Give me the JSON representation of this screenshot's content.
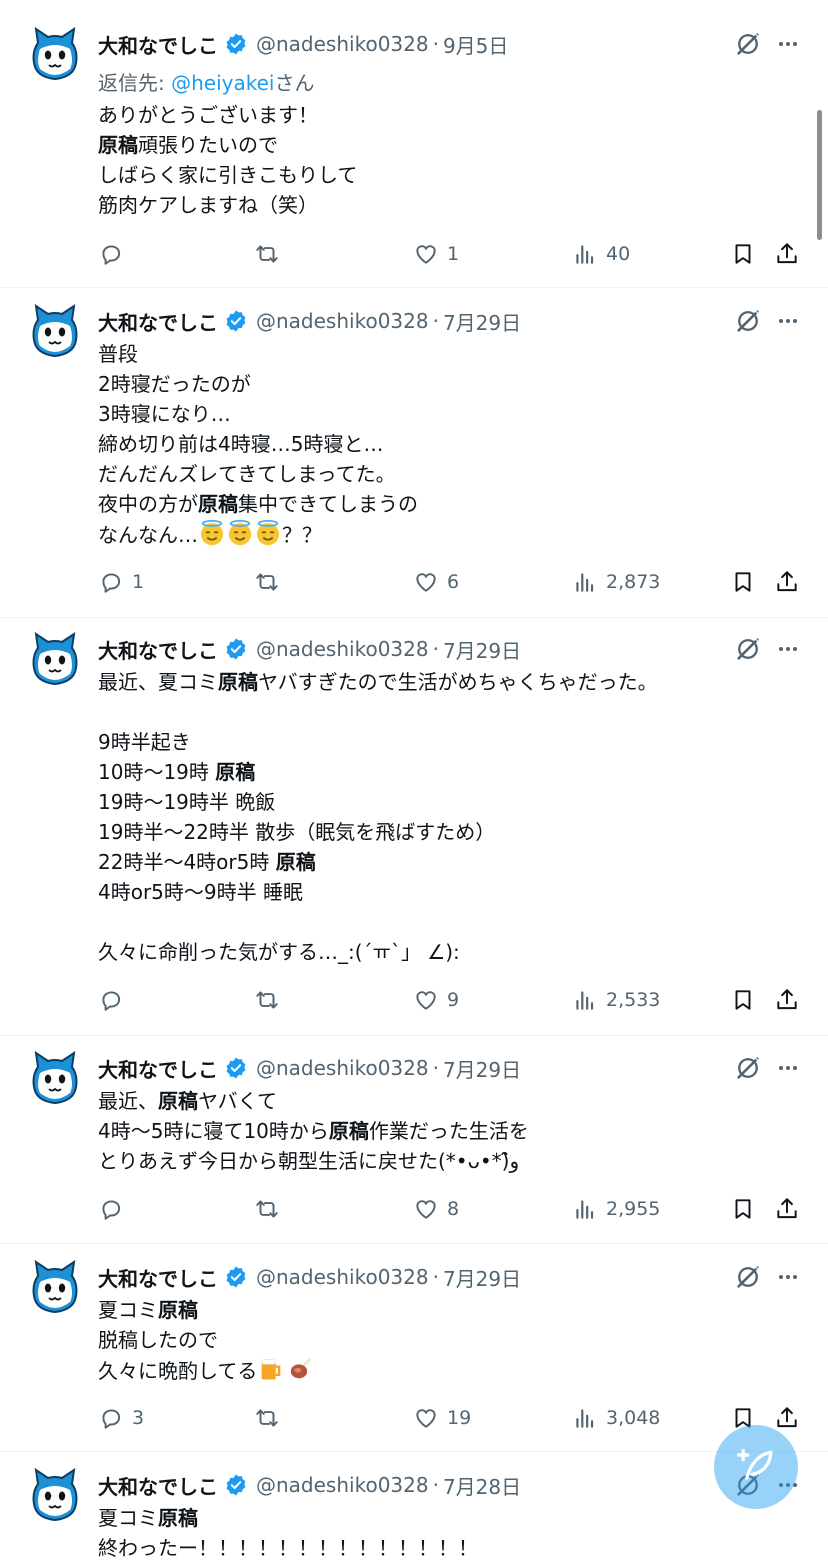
{
  "author": {
    "name": "大和なでしこ",
    "handle": "@nadeshiko0328",
    "separator": "·"
  },
  "icons": {
    "reply": "reply-icon",
    "retweet": "retweet-icon",
    "like": "heart-icon",
    "views": "views-chart-icon",
    "bookmark": "bookmark-icon",
    "share": "share-icon",
    "grok": "grok-icon",
    "more": "more-icon",
    "verified": "verified-badge-icon",
    "compose": "compose-icon"
  },
  "colors": {
    "accent": "#1d9bf0",
    "muted": "#536471",
    "text": "#0f1419"
  },
  "tweets": [
    {
      "date": "9月5日",
      "reply_to": {
        "prefix": "返信先: ",
        "mention": "@heiyakei",
        "suffix": "さん"
      },
      "lines": [
        [
          {
            "t": "ありがとうございます！"
          }
        ],
        [
          {
            "t": "原稿",
            "b": true
          },
          {
            "t": "頑張りたいので"
          }
        ],
        [
          {
            "t": "しばらく家に引きこもりして"
          }
        ],
        [
          {
            "t": "筋肉ケアしますね（笑）"
          }
        ]
      ],
      "replies": "",
      "retweets": "",
      "likes": "1",
      "views": "40"
    },
    {
      "date": "7月29日",
      "lines": [
        [
          {
            "t": "普段"
          }
        ],
        [
          {
            "t": "2時寝だったのが"
          }
        ],
        [
          {
            "t": "3時寝になり…"
          }
        ],
        [
          {
            "t": "締め切り前は4時寝…5時寝と…"
          }
        ],
        [
          {
            "t": "だんだんズレてきてしまってた。"
          }
        ],
        [
          {
            "t": "夜中の方が"
          },
          {
            "t": "原稿",
            "b": true
          },
          {
            "t": "集中できてしまうの"
          }
        ],
        [
          {
            "t": "なんなん…"
          },
          {
            "emoji": "halo"
          },
          {
            "emoji": "halo"
          },
          {
            "emoji": "halo"
          },
          {
            "t": "？？"
          }
        ]
      ],
      "replies": "1",
      "retweets": "",
      "likes": "6",
      "views": "2,873"
    },
    {
      "date": "7月29日",
      "lines": [
        [
          {
            "t": "最近、夏コミ"
          },
          {
            "t": "原稿",
            "b": true
          },
          {
            "t": "ヤバすぎたので生活がめちゃくちゃだった。"
          }
        ],
        [
          {
            "t": ""
          }
        ],
        [
          {
            "t": "9時半起き"
          }
        ],
        [
          {
            "t": "10時〜19時 "
          },
          {
            "t": "原稿",
            "b": true
          }
        ],
        [
          {
            "t": "19時〜19時半 晩飯"
          }
        ],
        [
          {
            "t": "19時半〜22時半 散歩（眠気を飛ばすため）"
          }
        ],
        [
          {
            "t": "22時半〜4時or5時 "
          },
          {
            "t": "原稿",
            "b": true
          }
        ],
        [
          {
            "t": "4時or5時〜9時半 睡眠"
          }
        ],
        [
          {
            "t": ""
          }
        ],
        [
          {
            "t": "久々に命削った気がする…_:(´ㅠ`」 ∠):"
          }
        ]
      ],
      "replies": "",
      "retweets": "",
      "likes": "9",
      "views": "2,533"
    },
    {
      "date": "7月29日",
      "lines": [
        [
          {
            "t": "最近、"
          },
          {
            "t": "原稿",
            "b": true
          },
          {
            "t": "ヤバくて"
          }
        ],
        [
          {
            "t": "4時〜5時に寝て10時から"
          },
          {
            "t": "原稿",
            "b": true
          },
          {
            "t": "作業だった生活を"
          }
        ],
        [
          {
            "t": "とりあえず今日から朝型生活に戻せた(*•ᴗ•*)و̑̑"
          }
        ]
      ],
      "replies": "",
      "retweets": "",
      "likes": "8",
      "views": "2,955"
    },
    {
      "date": "7月29日",
      "lines": [
        [
          {
            "t": "夏コミ"
          },
          {
            "t": "原稿",
            "b": true
          }
        ],
        [
          {
            "t": "脱稿したので"
          }
        ],
        [
          {
            "t": "久々に晩酌してる"
          },
          {
            "emoji": "beer"
          },
          {
            "emoji": "meat"
          }
        ]
      ],
      "replies": "3",
      "retweets": "",
      "likes": "19",
      "views": "3,048"
    },
    {
      "date": "7月28日",
      "lines": [
        [
          {
            "t": "夏コミ"
          },
          {
            "t": "原稿",
            "b": true
          }
        ],
        [
          {
            "t": "終わったー！！！！！！！！！！！！！！"
          }
        ]
      ],
      "replies": "",
      "retweets": "",
      "likes": "",
      "views": ""
    }
  ]
}
